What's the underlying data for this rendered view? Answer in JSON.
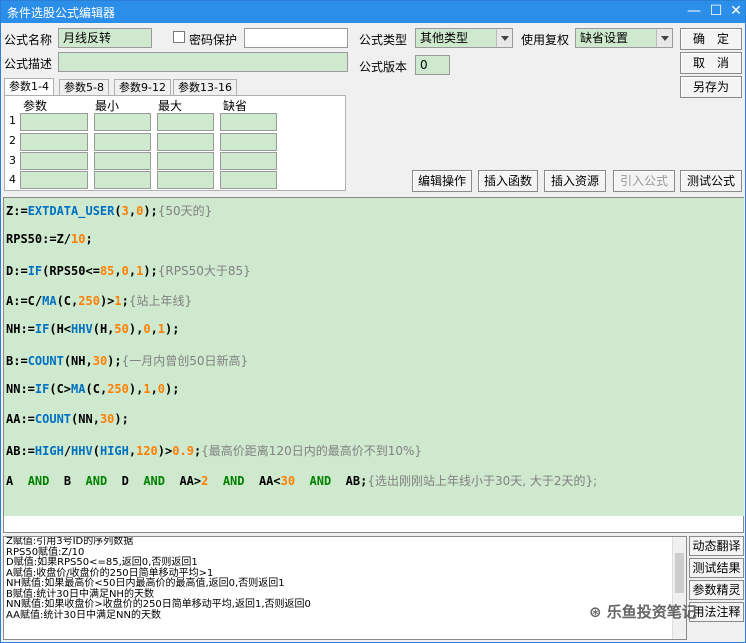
{
  "window": {
    "title": "条件选股公式编辑器",
    "minimize": "—",
    "maximize": "☐",
    "close": "✕"
  },
  "form": {
    "name_label": "公式名称",
    "name_value": "月线反转",
    "password_label": "密码保护",
    "password_checked": false,
    "password_value": "",
    "desc_label": "公式描述",
    "desc_value": "",
    "type_label": "公式类型",
    "type_value": "其他类型",
    "rights_label": "使用复权",
    "rights_value": "缺省设置",
    "version_label": "公式版本",
    "version_value": "0"
  },
  "buttons": {
    "ok": "确　定",
    "cancel": "取　消",
    "save_as": "另存为",
    "edit_op": "编辑操作",
    "insert_fn": "插入函数",
    "insert_res": "插入资源",
    "import_formula": "引入公式",
    "test_formula": "测试公式"
  },
  "tabs": [
    "参数1-4",
    "参数5-8",
    "参数9-12",
    "参数13-16"
  ],
  "params": {
    "headers": [
      "参数",
      "最小",
      "最大",
      "缺省"
    ],
    "rows": [
      "1",
      "2",
      "3",
      "4"
    ]
  },
  "code_lines": [
    [
      [
        "kw",
        "Z:="
      ],
      [
        "fn",
        "EXTDATA_USER"
      ],
      [
        "kw",
        "("
      ],
      [
        "num",
        "3"
      ],
      [
        "kw",
        ","
      ],
      [
        "num",
        "0"
      ],
      [
        "kw",
        ");"
      ],
      [
        "cm",
        "{50天的}"
      ]
    ],
    [
      [
        "kw",
        "RPS50:=Z/"
      ],
      [
        "num",
        "10"
      ],
      [
        "kw",
        ";"
      ]
    ],
    [
      [
        "kw",
        "D:="
      ],
      [
        "fn",
        "IF"
      ],
      [
        "kw",
        "(RPS50<="
      ],
      [
        "num",
        "85"
      ],
      [
        "kw",
        ","
      ],
      [
        "num",
        "0"
      ],
      [
        "kw",
        ","
      ],
      [
        "num",
        "1"
      ],
      [
        "kw",
        ");"
      ],
      [
        "cm",
        "{RPS50大于85}"
      ]
    ],
    [
      [
        "kw",
        "A:=C/"
      ],
      [
        "fn",
        "MA"
      ],
      [
        "kw",
        "(C,"
      ],
      [
        "num",
        "250"
      ],
      [
        "kw",
        ")>"
      ],
      [
        "num",
        "1"
      ],
      [
        "kw",
        ";"
      ],
      [
        "cm",
        "{站上年线}"
      ]
    ],
    [
      [
        "kw",
        "NH:="
      ],
      [
        "fn",
        "IF"
      ],
      [
        "kw",
        "(H<"
      ],
      [
        "fn",
        "HHV"
      ],
      [
        "kw",
        "(H,"
      ],
      [
        "num",
        "50"
      ],
      [
        "kw",
        "),"
      ],
      [
        "num",
        "0"
      ],
      [
        "kw",
        ","
      ],
      [
        "num",
        "1"
      ],
      [
        "kw",
        ");"
      ]
    ],
    [
      [
        "kw",
        "B:="
      ],
      [
        "fn",
        "COUNT"
      ],
      [
        "kw",
        "(NH,"
      ],
      [
        "num",
        "30"
      ],
      [
        "kw",
        ");"
      ],
      [
        "cm",
        "{一月内曾创50日新高}"
      ]
    ],
    [
      [
        "kw",
        "NN:="
      ],
      [
        "fn",
        "IF"
      ],
      [
        "kw",
        "(C>"
      ],
      [
        "fn",
        "MA"
      ],
      [
        "kw",
        "(C,"
      ],
      [
        "num",
        "250"
      ],
      [
        "kw",
        "),"
      ],
      [
        "num",
        "1"
      ],
      [
        "kw",
        ","
      ],
      [
        "num",
        "0"
      ],
      [
        "kw",
        ");"
      ]
    ],
    [
      [
        "kw",
        "AA:="
      ],
      [
        "fn",
        "COUNT"
      ],
      [
        "kw",
        "(NN,"
      ],
      [
        "num",
        "30"
      ],
      [
        "kw",
        ");"
      ]
    ],
    [
      [
        "kw",
        "AB:="
      ],
      [
        "fn",
        "HIGH"
      ],
      [
        "kw",
        "/"
      ],
      [
        "fn",
        "HHV"
      ],
      [
        "kw",
        "("
      ],
      [
        "fn",
        "HIGH"
      ],
      [
        "kw",
        ","
      ],
      [
        "num",
        "120"
      ],
      [
        "kw",
        ")>"
      ],
      [
        "num",
        "0.9"
      ],
      [
        "kw",
        ";"
      ],
      [
        "cm",
        "{最高价距离120日内的最高价不到10%}"
      ]
    ],
    [
      [
        "kw",
        "A  "
      ],
      [
        "and",
        "AND"
      ],
      [
        "kw",
        "  B  "
      ],
      [
        "and",
        "AND"
      ],
      [
        "kw",
        "  D  "
      ],
      [
        "and",
        "AND"
      ],
      [
        "kw",
        "  AA>"
      ],
      [
        "num",
        "2"
      ],
      [
        "kw",
        "  "
      ],
      [
        "and",
        "AND"
      ],
      [
        "kw",
        "  AA<"
      ],
      [
        "num",
        "30"
      ],
      [
        "kw",
        "  "
      ],
      [
        "and",
        "AND"
      ],
      [
        "kw",
        "  AB;"
      ],
      [
        "cm",
        "{选出刚刚站上年线小于30天, 大于2天的};"
      ]
    ]
  ],
  "status_lines": [
    "Z赋值:引用3号ID的序列数据",
    "RPS50赋值:Z/10",
    "D赋值:如果RPS50<=85,返回0,否则返回1",
    "A赋值:收盘价/收盘价的250日简单移动平均>1",
    "NH赋值:如果最高价<50日内最高价的最高值,返回0,否则返回1",
    "B赋值:统计30日中满足NH的天数",
    "NN赋值:如果收盘价>收盘价的250日简单移动平均,返回1,否则返回0",
    "AA赋值:统计30日中满足NN的天数"
  ],
  "side_buttons": [
    "动态翻译",
    "测试结果",
    "参数精灵",
    "用法注释"
  ],
  "watermark": "乐鱼投资笔记",
  "colors": {
    "titlebar": "#2b8ee8",
    "field_green": "#cfe9cf",
    "function": "#0070c0",
    "number": "#ff7f00",
    "comment": "#808080",
    "and_keyword": "#008000"
  }
}
